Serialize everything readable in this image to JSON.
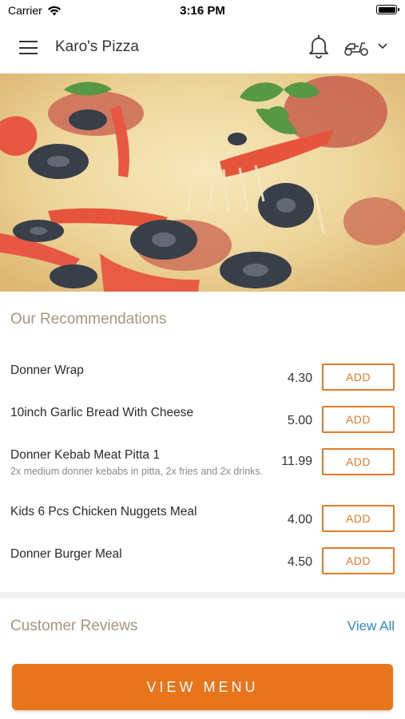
{
  "status_bar": {
    "carrier": "Carrier",
    "time": "3:16 PM"
  },
  "app_bar": {
    "title": "Karo's Pizza",
    "icons": [
      "menu-icon",
      "bell-icon",
      "scooter-icon",
      "chevron-down-icon"
    ]
  },
  "hero": {
    "icon": "pizza-image"
  },
  "recommendations": {
    "title": "Our Recommendations",
    "add_label": "ADD",
    "items": [
      {
        "name": "Donner Wrap",
        "description": "",
        "price": "4.30"
      },
      {
        "name": "10inch Garlic Bread With Cheese",
        "description": "",
        "price": "5.00"
      },
      {
        "name": "Donner Kebab Meat Pitta 1",
        "description": "2x medium donner kebabs in pitta, 2x fries and 2x drinks.",
        "price": "11.99"
      },
      {
        "name": "Kids 6 Pcs Chicken Nuggets Meal",
        "description": "",
        "price": "4.00"
      },
      {
        "name": "Donner Burger Meal",
        "description": "",
        "price": "4.50"
      }
    ]
  },
  "reviews": {
    "title": "Customer Reviews",
    "view_all": "View All"
  },
  "footer": {
    "view_menu": "VIEW MENU"
  },
  "colors": {
    "accent": "#e8741c",
    "section_title": "#a7957c",
    "link": "#2b8bd1"
  }
}
